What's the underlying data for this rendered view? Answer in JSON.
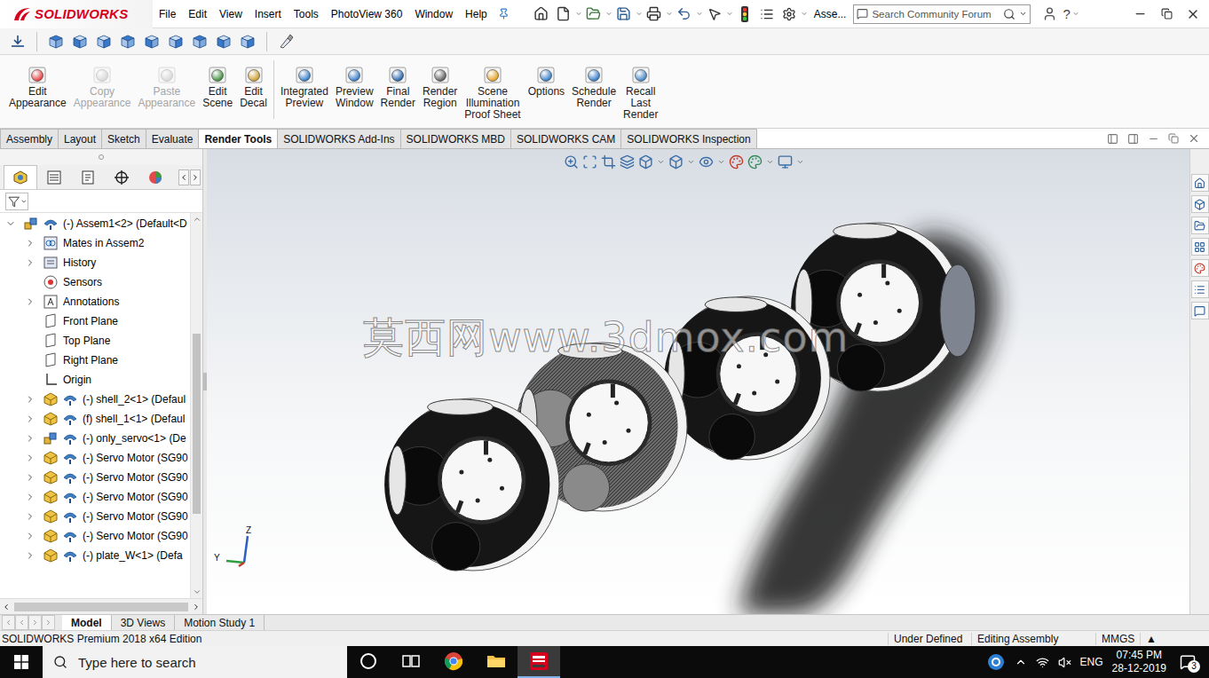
{
  "titlebar": {
    "logo": "SOLIDWORKS",
    "menu": [
      "File",
      "Edit",
      "View",
      "Insert",
      "Tools",
      "PhotoView 360",
      "Window",
      "Help"
    ],
    "document": "Asse...",
    "search": {
      "placeholder": "Search Community Forum"
    },
    "help": "?"
  },
  "ribbon": [
    {
      "lines": [
        "Edit",
        "Appearance"
      ],
      "disabled": false,
      "group": 1
    },
    {
      "lines": [
        "Copy",
        "Appearance"
      ],
      "disabled": true,
      "group": 1
    },
    {
      "lines": [
        "Paste",
        "Appearance"
      ],
      "disabled": true,
      "group": 1
    },
    {
      "lines": [
        "Edit",
        "Scene"
      ],
      "disabled": false,
      "group": 1
    },
    {
      "lines": [
        "Edit",
        "Decal"
      ],
      "disabled": false,
      "group": 1
    },
    {
      "lines": [
        "Integrated",
        "Preview"
      ],
      "disabled": false,
      "group": 2
    },
    {
      "lines": [
        "Preview",
        "Window"
      ],
      "disabled": false,
      "group": 2
    },
    {
      "lines": [
        "Final",
        "Render"
      ],
      "disabled": false,
      "group": 2
    },
    {
      "lines": [
        "Render",
        "Region"
      ],
      "disabled": false,
      "group": 2
    },
    {
      "lines": [
        "Scene",
        "Illumination",
        "Proof Sheet"
      ],
      "disabled": false,
      "group": 2
    },
    {
      "lines": [
        "Options"
      ],
      "disabled": false,
      "group": 2
    },
    {
      "lines": [
        "Schedule",
        "Render"
      ],
      "disabled": false,
      "group": 2
    },
    {
      "lines": [
        "Recall",
        "Last",
        "Render"
      ],
      "disabled": false,
      "group": 2
    }
  ],
  "tabs": [
    {
      "label": "Assembly",
      "selected": false
    },
    {
      "label": "Layout",
      "selected": false
    },
    {
      "label": "Sketch",
      "selected": false
    },
    {
      "label": "Evaluate",
      "selected": false
    },
    {
      "label": "Render Tools",
      "selected": true
    },
    {
      "label": "SOLIDWORKS Add-Ins",
      "selected": false
    },
    {
      "label": "SOLIDWORKS MBD",
      "selected": false
    },
    {
      "label": "SOLIDWORKS CAM",
      "selected": false
    },
    {
      "label": "SOLIDWORKS Inspection",
      "selected": false
    }
  ],
  "feature_tree": {
    "panel_tabs": [
      {
        "kind": "feature",
        "selected": true
      },
      {
        "kind": "property",
        "selected": false
      },
      {
        "kind": "configuration",
        "selected": false
      },
      {
        "kind": "dimxpert",
        "selected": false
      },
      {
        "kind": "display",
        "selected": false
      }
    ],
    "scroll_thumb": {
      "start": 0.3,
      "size": 0.5
    },
    "items": [
      {
        "label": "(-) Assem1<2> (Default<D",
        "kind": "assembly",
        "level": 0,
        "has_children": true,
        "expanded": true
      },
      {
        "label": "Mates in Assem2",
        "kind": "mates",
        "level": 1,
        "has_children": true,
        "expanded": false
      },
      {
        "label": "History",
        "kind": "history",
        "level": 1,
        "has_children": true,
        "expanded": false
      },
      {
        "label": "Sensors",
        "kind": "sensors",
        "level": 1,
        "has_children": false,
        "expanded": false
      },
      {
        "label": "Annotations",
        "kind": "annotations",
        "level": 1,
        "has_children": true,
        "expanded": false
      },
      {
        "label": "Front Plane",
        "kind": "plane",
        "level": 1,
        "has_children": false,
        "expanded": false
      },
      {
        "label": "Top Plane",
        "kind": "plane",
        "level": 1,
        "has_children": false,
        "expanded": false
      },
      {
        "label": "Right Plane",
        "kind": "plane",
        "level": 1,
        "has_children": false,
        "expanded": false
      },
      {
        "label": "Origin",
        "kind": "origin",
        "level": 1,
        "has_children": false,
        "expanded": false
      },
      {
        "label": "(-) shell_2<1> (Defaul",
        "kind": "part",
        "level": 1,
        "has_children": true,
        "expanded": false
      },
      {
        "label": "(f) shell_1<1> (Defaul",
        "kind": "part",
        "level": 1,
        "has_children": true,
        "expanded": false
      },
      {
        "label": "(-) only_servo<1> (De",
        "kind": "subassembly",
        "level": 1,
        "has_children": true,
        "expanded": false
      },
      {
        "label": "(-) Servo Motor (SG90",
        "kind": "part",
        "level": 1,
        "has_children": true,
        "expanded": false
      },
      {
        "label": "(-) Servo Motor (SG90",
        "kind": "part",
        "level": 1,
        "has_children": true,
        "expanded": false
      },
      {
        "label": "(-) Servo Motor (SG90",
        "kind": "part",
        "level": 1,
        "has_children": true,
        "expanded": false
      },
      {
        "label": "(-) Servo Motor (SG90",
        "kind": "part",
        "level": 1,
        "has_children": true,
        "expanded": false
      },
      {
        "label": "(-) Servo Motor (SG90",
        "kind": "part",
        "level": 1,
        "has_children": true,
        "expanded": false
      },
      {
        "label": "(-) plate_W<1> (Defa",
        "kind": "part",
        "level": 1,
        "has_children": true,
        "expanded": false
      }
    ]
  },
  "viewport": {
    "watermark": "莫西网www.3dmox.com",
    "triad": {
      "z": "Z",
      "y": "Y"
    }
  },
  "bottom_tabs": [
    {
      "label": "Model",
      "selected": true
    },
    {
      "label": "3D Views",
      "selected": false
    },
    {
      "label": "Motion Study 1",
      "selected": false
    }
  ],
  "status_bar": {
    "edition": "SOLIDWORKS Premium 2018 x64 Edition",
    "state": "Under Defined",
    "mode": "Editing Assembly",
    "units": "MMGS",
    "units_arrow": "▲"
  },
  "taskbar": {
    "search_placeholder": "Type here to search",
    "apps": [
      {
        "kind": "cortana",
        "active": false
      },
      {
        "kind": "task-view",
        "active": false
      },
      {
        "kind": "chrome",
        "active": false
      },
      {
        "kind": "explorer",
        "active": false
      },
      {
        "kind": "solidworks",
        "active": true
      }
    ],
    "language": "ENG",
    "time": "07:45 PM",
    "date": "28-12-2019",
    "notifications": "3"
  }
}
